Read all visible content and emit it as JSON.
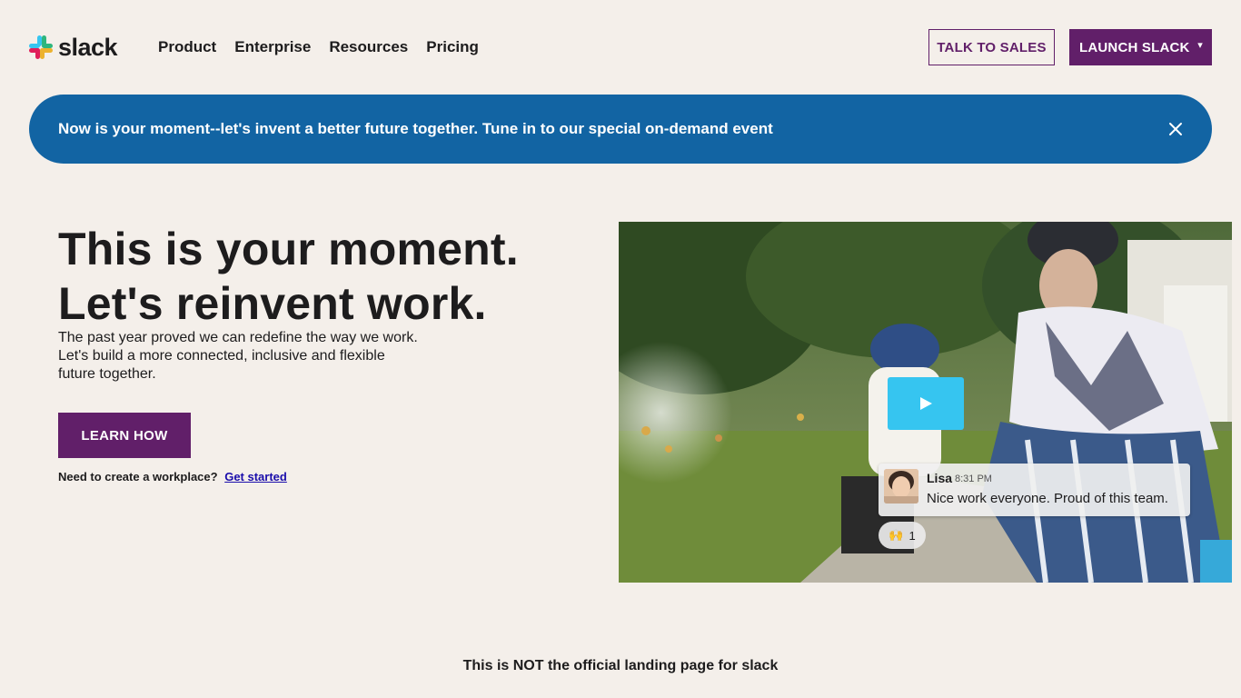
{
  "header": {
    "logo_text": "slack",
    "nav": [
      {
        "label": "Product"
      },
      {
        "label": "Enterprise"
      },
      {
        "label": "Resources"
      },
      {
        "label": "Pricing"
      }
    ],
    "talk_to_sales": "TALK TO SALES",
    "launch_slack": "LAUNCH SLACK",
    "launch_caret": "▾"
  },
  "banner": {
    "text": "Now is your moment--let's invent a better future together. Tune in to our special on-demand event",
    "close_icon": "close-icon"
  },
  "hero": {
    "title_line1": "This is your moment.",
    "title_line2": "Let's reinvent work.",
    "body": "The past year proved we can redefine the way we work. Let's build a more connected, inclusive and flexible future together.",
    "cta": "LEARN HOW",
    "workspace_prompt": "Need to create a workplace?",
    "workspace_link": "Get started"
  },
  "video": {
    "play_icon": "play-icon",
    "message": {
      "name": "Lisa",
      "time": "8:31 PM",
      "text": "Nice work everyone. Proud of this team."
    },
    "reaction": {
      "emoji": "🙌",
      "count": "1"
    }
  },
  "footer": {
    "note": "This is NOT the official landing page for slack"
  },
  "colors": {
    "background": "#f4efea",
    "aubergine": "#611f69",
    "banner_blue": "#1264a3",
    "play_blue": "#36c5f0"
  }
}
